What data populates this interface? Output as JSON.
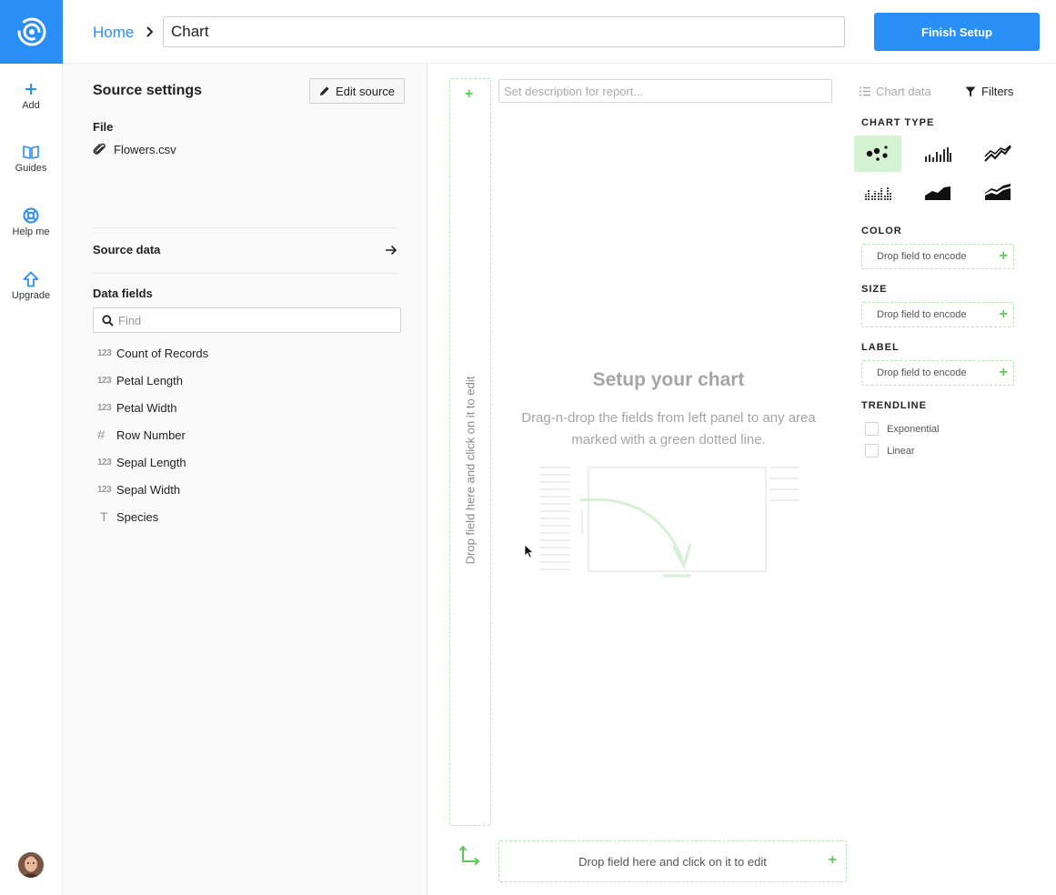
{
  "rail": {
    "items": [
      {
        "label": "Add"
      },
      {
        "label": "Guides"
      },
      {
        "label": "Help me"
      },
      {
        "label": "Upgrade"
      }
    ]
  },
  "header": {
    "home": "Home",
    "title_value": "Chart",
    "finish_label": "Finish Setup"
  },
  "source": {
    "title": "Source settings",
    "edit_label": "Edit source",
    "file_heading": "File",
    "file_name": "Flowers.csv",
    "source_data_label": "Source data",
    "data_fields_heading": "Data fields",
    "find_placeholder": "Find",
    "fields": [
      {
        "type": "123",
        "name": "Count of Records"
      },
      {
        "type": "123",
        "name": "Petal Length"
      },
      {
        "type": "123",
        "name": "Petal Width"
      },
      {
        "type": "#",
        "name": "Row Number"
      },
      {
        "type": "123",
        "name": "Sepal Length"
      },
      {
        "type": "123",
        "name": "Sepal Width"
      },
      {
        "type": "T",
        "name": "Species"
      }
    ]
  },
  "canvas": {
    "description_placeholder": "Set description for report...",
    "y_drop_label": "Drop field here and click on it to edit",
    "x_drop_label": "Drop field here and click on it to edit",
    "setup_title": "Setup your chart",
    "setup_text": "Drag-n-drop the fields from left panel to any area marked with a green dotted line."
  },
  "props": {
    "chart_data_tab": "Chart data",
    "filters_tab": "Filters",
    "chart_type_heading": "CHART TYPE",
    "selected_chart_type": "scatter",
    "color_heading": "COLOR",
    "size_heading": "SIZE",
    "label_heading": "LABEL",
    "encode_placeholder": "Drop field to encode",
    "trendline_heading": "TRENDLINE",
    "trendlines": [
      {
        "label": "Exponential",
        "checked": false
      },
      {
        "label": "Linear",
        "checked": false
      }
    ]
  },
  "colors": {
    "accent": "#2a8ef7",
    "drop_border": "#b9e3b9",
    "plus_green": "#5ccb5c",
    "selected_bg": "#d4f3d1"
  }
}
